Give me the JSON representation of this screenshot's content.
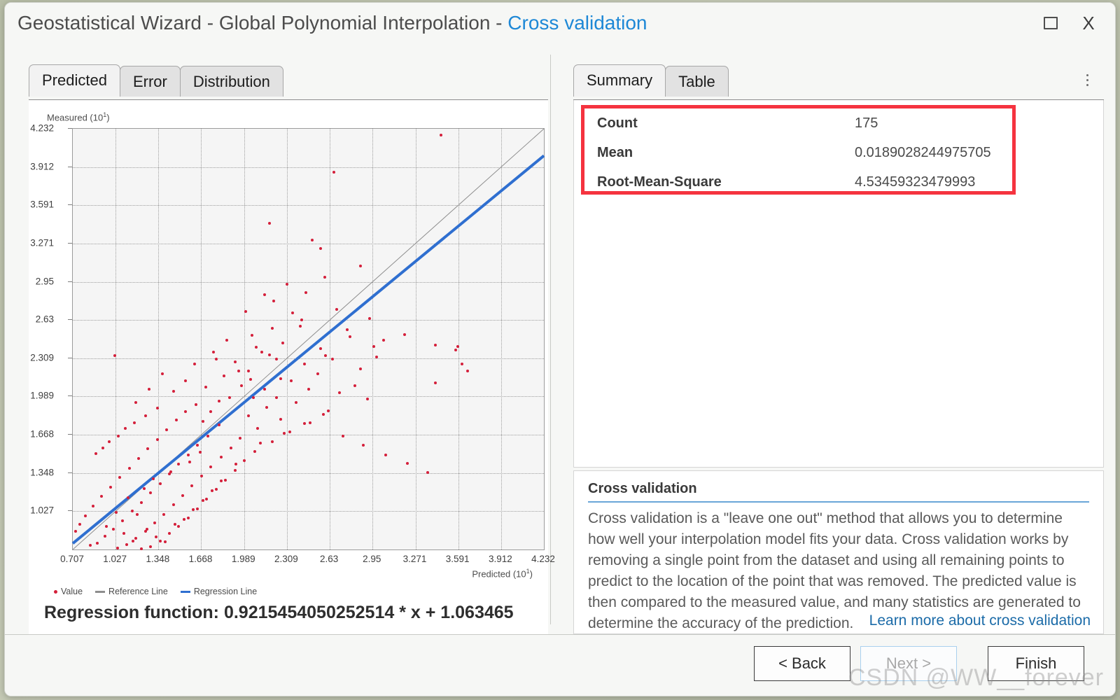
{
  "window": {
    "title_main": "Geostatistical Wizard - Global Polynomial Interpolation",
    "title_separator": " - ",
    "title_accent": "Cross validation",
    "restore_label": "Restore",
    "close_label": "X"
  },
  "left_panel": {
    "tabs": [
      {
        "label": "Predicted",
        "active": true
      },
      {
        "label": "Error",
        "active": false
      },
      {
        "label": "Distribution",
        "active": false
      }
    ],
    "regression_function": "Regression function: 0.9215454050252514 * x + 1.063465",
    "legend": [
      {
        "label": "Value",
        "type": "dot",
        "color": "#d41f3a"
      },
      {
        "label": "Reference Line",
        "type": "line",
        "color": "#8e8e8e"
      },
      {
        "label": "Regression Line",
        "type": "line",
        "color": "#2f6fd0"
      }
    ]
  },
  "right_panel": {
    "tabs": [
      {
        "label": "Summary",
        "active": true
      },
      {
        "label": "Table",
        "active": false
      }
    ],
    "kebab_label": "More options",
    "stats": [
      {
        "label": "Count",
        "value": "175"
      },
      {
        "label": "Mean",
        "value": "0.0189028244975705"
      },
      {
        "label": "Root-Mean-Square",
        "value": "4.53459323479993"
      }
    ],
    "highlight_color": "#f5333f",
    "description": {
      "title": "Cross validation",
      "body": "Cross validation is a \"leave one out\" method that allows you to determine how well your interpolation model fits your data. Cross validation works by removing a single point from the dataset and using all remaining points to predict to the location of the point that was removed. The predicted value is then compared to the measured value, and many statistics are generated to determine the accuracy of the prediction.",
      "link": "Learn more about cross validation"
    }
  },
  "footer": {
    "back_label": "< Back",
    "next_label": "Next >",
    "finish_label": "Finish",
    "watermark": "CSDN @WW__forever"
  },
  "chart_data": {
    "type": "scatter",
    "title": "",
    "xlabel": "Predicted (10^1)",
    "ylabel": "Measured (10^1)",
    "xlabel_base": "Predicted (10",
    "xlabel_exp": "1",
    "ylabel_base": "Measured (10",
    "ylabel_exp": "1",
    "xticks": [
      0.707,
      1.027,
      1.348,
      1.668,
      1.989,
      2.309,
      2.63,
      2.95,
      3.271,
      3.591,
      3.912,
      4.232
    ],
    "yticks": [
      4.232,
      3.912,
      3.591,
      3.271,
      2.95,
      2.63,
      2.309,
      1.989,
      1.668,
      1.348,
      1.027
    ],
    "xlim": [
      0.707,
      4.232
    ],
    "ylim": [
      0.707,
      4.232
    ],
    "grid": true,
    "point_color": "#d41f3a",
    "reference_line": {
      "slope": 1,
      "intercept": 0,
      "color": "#8e8e8e",
      "label": "Reference Line"
    },
    "regression_line": {
      "slope": 0.9215454050252514,
      "intercept": 0.1063465,
      "color": "#2f6fd0",
      "label": "Regression Line"
    },
    "n_points": 175,
    "points": [
      [
        3.46,
        4.18
      ],
      [
        2.66,
        3.87
      ],
      [
        2.78,
        2.49
      ],
      [
        3.19,
        2.51
      ],
      [
        3.03,
        2.46
      ],
      [
        3.42,
        2.42
      ],
      [
        3.59,
        2.41
      ],
      [
        3.57,
        2.38
      ],
      [
        2.98,
        2.32
      ],
      [
        2.86,
        2.22
      ],
      [
        3.62,
        2.26
      ],
      [
        3.66,
        2.2
      ],
      [
        1.02,
        2.33
      ],
      [
        3.42,
        2.1
      ],
      [
        2.18,
        3.44
      ],
      [
        2.21,
        2.79
      ],
      [
        2.5,
        3.3
      ],
      [
        2.56,
        3.23
      ],
      [
        2.59,
        2.99
      ],
      [
        2.86,
        3.08
      ],
      [
        2.45,
        2.86
      ],
      [
        2.93,
        2.64
      ],
      [
        2.68,
        2.72
      ],
      [
        2.41,
        2.58
      ],
      [
        2.76,
        2.55
      ],
      [
        2.2,
        2.56
      ],
      [
        2.35,
        2.69
      ],
      [
        2.05,
        2.5
      ],
      [
        2.96,
        2.41
      ],
      [
        2.28,
        2.44
      ],
      [
        2.56,
        2.39
      ],
      [
        2.12,
        2.36
      ],
      [
        2.6,
        2.33
      ],
      [
        2.23,
        2.3
      ],
      [
        1.86,
        2.46
      ],
      [
        2.42,
        2.63
      ],
      [
        2.0,
        2.7
      ],
      [
        2.14,
        2.84
      ],
      [
        2.31,
        2.93
      ],
      [
        1.95,
        2.2
      ],
      [
        1.78,
        2.3
      ],
      [
        2.04,
        2.13
      ],
      [
        2.47,
        2.05
      ],
      [
        2.7,
        2.02
      ],
      [
        1.7,
        2.07
      ],
      [
        2.91,
        1.97
      ],
      [
        2.38,
        1.94
      ],
      [
        2.16,
        1.9
      ],
      [
        1.88,
        1.98
      ],
      [
        2.62,
        1.87
      ],
      [
        1.63,
        1.92
      ],
      [
        2.02,
        1.83
      ],
      [
        2.26,
        1.8
      ],
      [
        1.55,
        1.86
      ],
      [
        2.48,
        1.77
      ],
      [
        1.8,
        1.75
      ],
      [
        2.09,
        1.72
      ],
      [
        1.48,
        1.79
      ],
      [
        2.33,
        1.69
      ],
      [
        1.72,
        1.66
      ],
      [
        1.96,
        1.64
      ],
      [
        1.41,
        1.71
      ],
      [
        2.2,
        1.61
      ],
      [
        1.64,
        1.58
      ],
      [
        1.89,
        1.56
      ],
      [
        1.34,
        1.63
      ],
      [
        2.07,
        1.53
      ],
      [
        1.57,
        1.5
      ],
      [
        1.82,
        1.48
      ],
      [
        1.27,
        1.55
      ],
      [
        1.99,
        1.45
      ],
      [
        1.5,
        1.42
      ],
      [
        1.74,
        1.4
      ],
      [
        1.2,
        1.47
      ],
      [
        1.92,
        1.37
      ],
      [
        1.43,
        1.34
      ],
      [
        1.67,
        1.32
      ],
      [
        1.13,
        1.39
      ],
      [
        1.85,
        1.29
      ],
      [
        1.36,
        1.26
      ],
      [
        1.6,
        1.24
      ],
      [
        1.06,
        1.31
      ],
      [
        1.78,
        1.21
      ],
      [
        1.29,
        1.18
      ],
      [
        1.53,
        1.16
      ],
      [
        0.99,
        1.23
      ],
      [
        1.71,
        1.13
      ],
      [
        1.22,
        1.1
      ],
      [
        1.46,
        1.08
      ],
      [
        0.92,
        1.15
      ],
      [
        1.64,
        1.05
      ],
      [
        1.15,
        1.03
      ],
      [
        1.39,
        1.0
      ],
      [
        0.86,
        1.07
      ],
      [
        1.57,
        0.97
      ],
      [
        1.08,
        0.95
      ],
      [
        1.32,
        0.93
      ],
      [
        0.8,
        0.99
      ],
      [
        1.5,
        0.9
      ],
      [
        1.01,
        0.88
      ],
      [
        1.25,
        0.86
      ],
      [
        0.76,
        0.92
      ],
      [
        1.43,
        0.84
      ],
      [
        0.95,
        0.82
      ],
      [
        1.18,
        0.8
      ],
      [
        0.73,
        0.86
      ],
      [
        1.36,
        0.78
      ],
      [
        0.89,
        0.76
      ],
      [
        1.11,
        0.75
      ],
      [
        1.29,
        0.73
      ],
      [
        0.84,
        0.74
      ],
      [
        1.04,
        0.72
      ],
      [
        1.22,
        0.71
      ],
      [
        1.16,
        0.78
      ],
      [
        1.33,
        0.81
      ],
      [
        1.4,
        0.77
      ],
      [
        1.09,
        0.84
      ],
      [
        1.26,
        0.88
      ],
      [
        1.47,
        0.92
      ],
      [
        0.96,
        0.9
      ],
      [
        1.54,
        0.96
      ],
      [
        1.19,
        1.0
      ],
      [
        1.61,
        1.04
      ],
      [
        1.03,
        1.02
      ],
      [
        1.68,
        1.12
      ],
      [
        1.12,
        1.14
      ],
      [
        1.75,
        1.2
      ],
      [
        1.24,
        1.22
      ],
      [
        1.82,
        1.28
      ],
      [
        1.31,
        1.3
      ],
      [
        1.44,
        1.36
      ],
      [
        1.58,
        1.44
      ],
      [
        1.66,
        1.52
      ],
      [
        1.93,
        1.42
      ],
      [
        2.11,
        1.6
      ],
      [
        2.29,
        1.68
      ],
      [
        2.44,
        1.76
      ],
      [
        2.58,
        1.84
      ],
      [
        2.73,
        1.66
      ],
      [
        2.88,
        1.58
      ],
      [
        3.05,
        1.5
      ],
      [
        3.21,
        1.43
      ],
      [
        3.36,
        1.35
      ],
      [
        1.46,
        2.03
      ],
      [
        1.38,
        2.18
      ],
      [
        1.28,
        2.05
      ],
      [
        1.18,
        1.94
      ],
      [
        1.55,
        2.12
      ],
      [
        1.62,
        2.26
      ],
      [
        1.76,
        2.36
      ],
      [
        1.84,
        2.16
      ],
      [
        1.92,
        2.28
      ],
      [
        2.02,
        2.2
      ],
      [
        2.08,
        2.4
      ],
      [
        2.18,
        2.34
      ],
      [
        2.26,
        2.14
      ],
      [
        1.34,
        1.89
      ],
      [
        1.25,
        1.83
      ],
      [
        1.17,
        1.77
      ],
      [
        1.1,
        1.72
      ],
      [
        1.05,
        1.66
      ],
      [
        0.98,
        1.61
      ],
      [
        0.93,
        1.56
      ],
      [
        0.88,
        1.51
      ],
      [
        1.68,
        1.78
      ],
      [
        1.74,
        1.86
      ],
      [
        1.8,
        1.95
      ],
      [
        1.97,
        2.08
      ],
      [
        2.06,
        1.98
      ],
      [
        2.14,
        2.05
      ],
      [
        2.23,
        1.98
      ],
      [
        2.34,
        2.12
      ],
      [
        2.44,
        2.26
      ],
      [
        2.54,
        2.18
      ],
      [
        2.65,
        2.3
      ],
      [
        2.82,
        2.08
      ]
    ]
  }
}
